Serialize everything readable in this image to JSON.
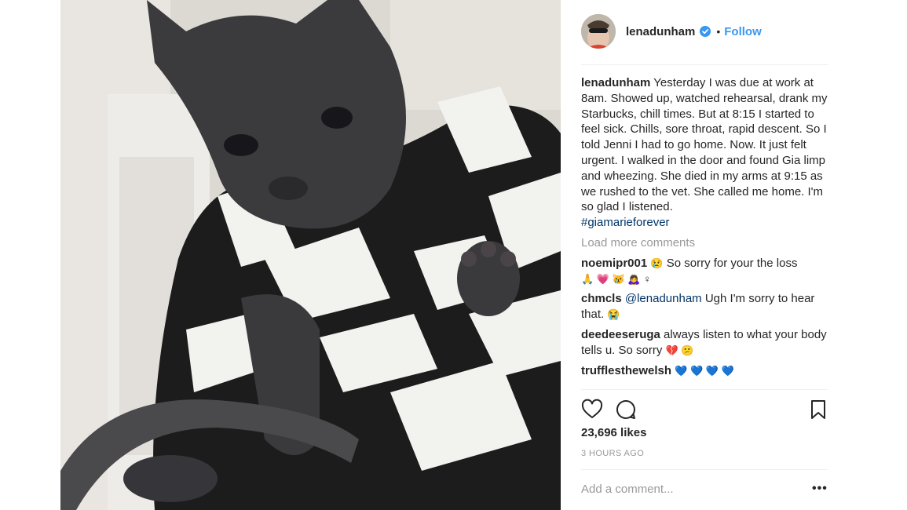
{
  "post": {
    "username": "lenadunham",
    "follow_label": "Follow",
    "separator": "•",
    "caption_text": " Yesterday I was due at work at 8am. Showed up, watched rehearsal, drank my Starbucks, chill times. But at 8:15 I started to feel sick. Chills, sore throat, rapid descent. So I told Jenni I had to go home. Now. It just felt urgent. I walked in the door and found Gia limp and wheezing. She died in my arms at 9:15 as we rushed to the vet. She called me home. I'm so glad I listened.",
    "hashtag": "#giamarieforever",
    "load_more_label": "Load more comments",
    "likes": "23,696 likes",
    "timestamp": "3 HOURS AGO",
    "add_comment_placeholder": "Add a comment...",
    "more_label": "•••"
  },
  "comments": [
    {
      "user": "noemipr001",
      "pre_emoji": "😢",
      "text": "  So sorry for your the loss",
      "emoji_line": "🙏 💗 😿 🙇‍♀️ ♀"
    },
    {
      "user": "chmcls",
      "mention": "@lenadunham",
      "text": " Ugh I'm sorry to hear that. ",
      "emoji": "😭"
    },
    {
      "user": "deedeeseruga",
      "text": " always listen to what your body tells u. So sorry ",
      "emoji": "💔 😕"
    },
    {
      "user": "trufflesthewelsh",
      "emoji": "💙 💙 💙 💙"
    }
  ],
  "colors": {
    "link_blue": "#3897f0",
    "hashtag": "#003569",
    "muted": "#999999",
    "text": "#262626",
    "verified_badge": "#3897f0"
  },
  "icons": [
    "verified-badge-icon",
    "heart-icon",
    "comment-icon",
    "bookmark-icon",
    "more-options-icon"
  ]
}
